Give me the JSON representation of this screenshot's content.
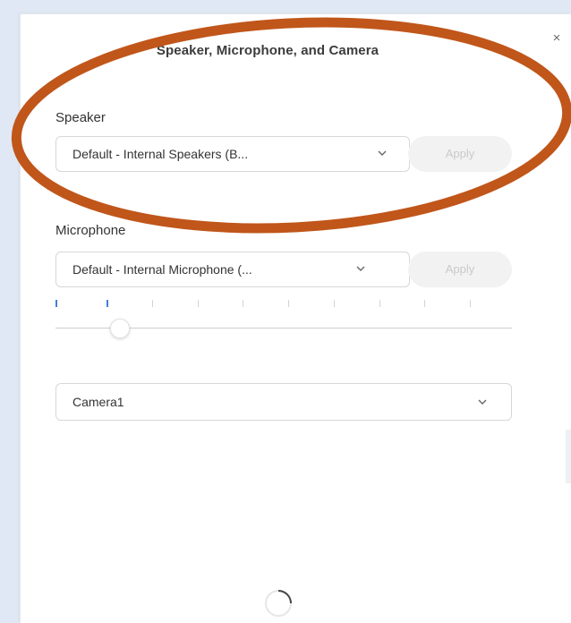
{
  "dialog": {
    "title": "Speaker, Microphone, and Camera",
    "close_glyph": "×"
  },
  "speaker": {
    "label": "Speaker",
    "selected": "Default - Internal Speakers (B...",
    "apply_label": "Apply"
  },
  "microphone": {
    "label": "Microphone",
    "selected": "Default - Internal Microphone (...",
    "apply_label": "Apply",
    "level_ticks_total": 10,
    "level_ticks_active": 2,
    "volume_fraction": 0.12
  },
  "camera": {
    "selected": "Camera1"
  },
  "icons": {
    "close": "close-icon",
    "dropdown": "chevron-down-icon",
    "loading": "loading-spinner-icon"
  },
  "colors": {
    "annotation": "#c0561a",
    "level_active": "#3f7fd6",
    "background": "#dfe8f4"
  }
}
